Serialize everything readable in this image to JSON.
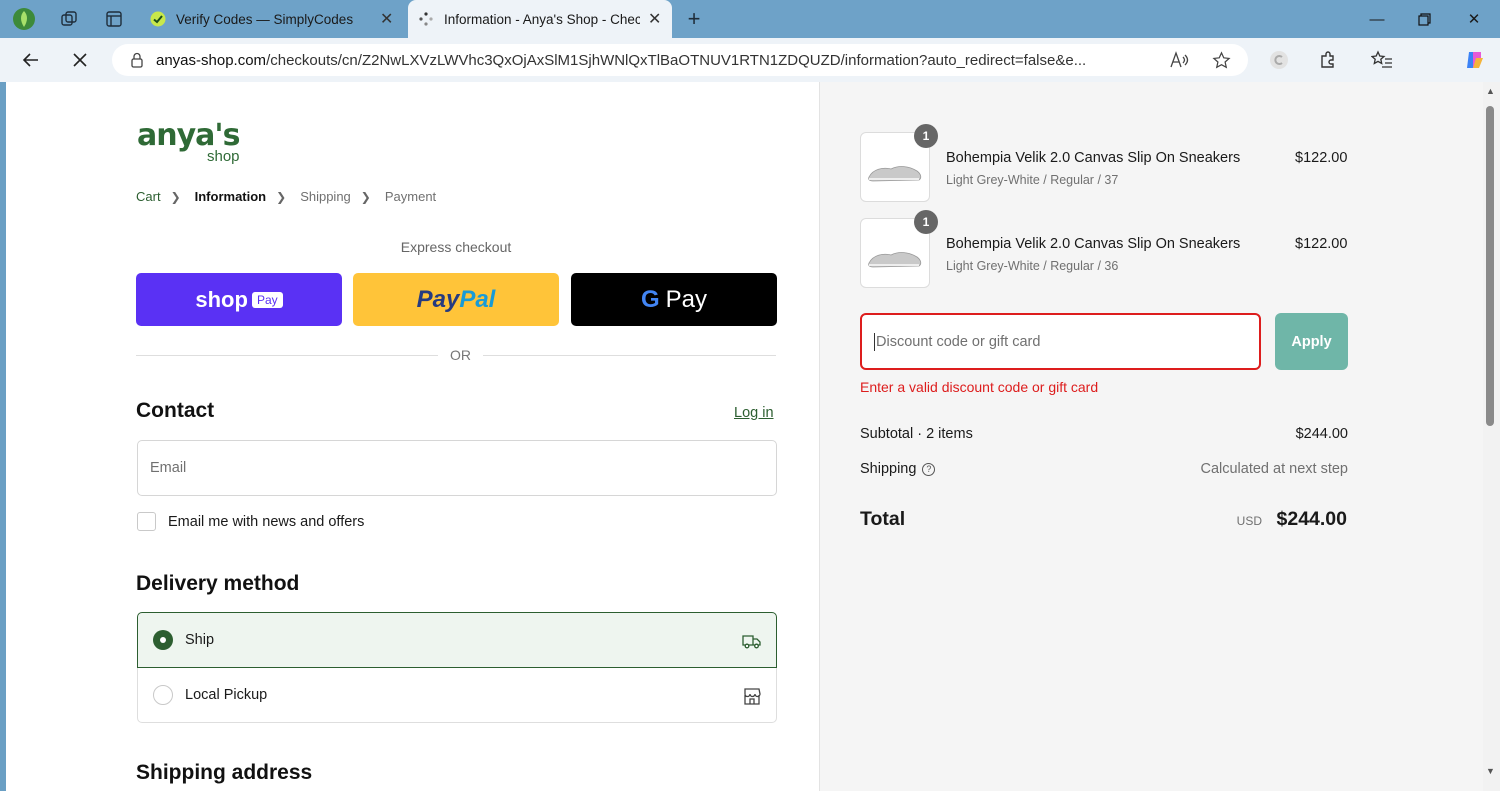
{
  "browser": {
    "tabs": [
      {
        "title": "Verify Codes — SimplyCodes"
      },
      {
        "title": "Information - Anya's Shop - Checkout"
      }
    ],
    "url_domain": "anyas-shop.com",
    "url_rest": "/checkouts/cn/Z2NwLXVzLWVhc3QxOjAxSlM1SjhWNlQxTlBaOTNUV1RTN1ZDQUZD/information?auto_redirect=false&e..."
  },
  "shop": {
    "logo_main": "anya's",
    "logo_sub": "shop"
  },
  "breadcrumb": {
    "cart": "Cart",
    "information": "Information",
    "shipping": "Shipping",
    "payment": "Payment"
  },
  "express": {
    "heading": "Express checkout",
    "shop_pay": "shop",
    "shop_pay_pill": "Pay",
    "paypal_a": "Pay",
    "paypal_b": "Pal",
    "gpay_g": "G",
    "gpay_label": "Pay",
    "or": "OR"
  },
  "contact": {
    "heading": "Contact",
    "login": "Log in",
    "email_placeholder": "Email",
    "newsletter_label": "Email me with news and offers"
  },
  "delivery": {
    "heading": "Delivery method",
    "ship": "Ship",
    "pickup": "Local Pickup"
  },
  "shipping_address": {
    "heading": "Shipping address"
  },
  "order": {
    "items": [
      {
        "qty": "1",
        "name": "Bohempia Velik 2.0 Canvas Slip On Sneakers",
        "variant": "Light Grey-White / Regular / 37",
        "price": "$122.00"
      },
      {
        "qty": "1",
        "name": "Bohempia Velik 2.0 Canvas Slip On Sneakers",
        "variant": "Light Grey-White / Regular / 36",
        "price": "$122.00"
      }
    ],
    "discount_placeholder": "Discount code or gift card",
    "apply": "Apply",
    "error": "Enter a valid discount code or gift card",
    "subtotal_label": "Subtotal · 2 items",
    "subtotal_value": "$244.00",
    "shipping_label": "Shipping",
    "shipping_value": "Calculated at next step",
    "total_label": "Total",
    "currency": "USD",
    "total_value": "$244.00"
  },
  "colors": {
    "brand_green": "#2c5e30",
    "shop_pay": "#5a31f4",
    "paypal": "#ffc439",
    "error_red": "#dd1d1d",
    "apply_teal": "#6fb6a8"
  }
}
